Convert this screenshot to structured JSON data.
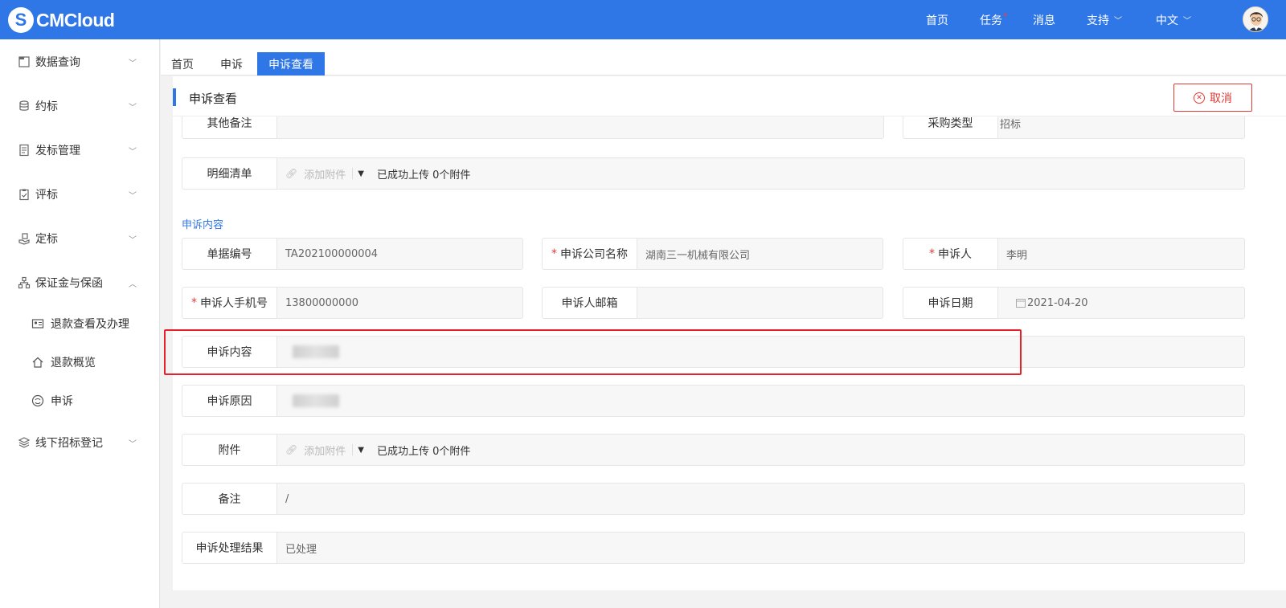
{
  "header": {
    "logo_text": "CMCloud",
    "logo_mark": "S",
    "nav": {
      "home": "首页",
      "tasks": "任务",
      "tasks_badge": "*",
      "messages": "消息",
      "support": "支持",
      "language": "中文"
    }
  },
  "sidebar": {
    "items": [
      {
        "label": "数据查询",
        "icon": "data-query-icon"
      },
      {
        "label": "约标",
        "icon": "coins-icon"
      },
      {
        "label": "发标管理",
        "icon": "document-icon"
      },
      {
        "label": "评标",
        "icon": "clipboard-icon"
      },
      {
        "label": "定标",
        "icon": "hand-icon"
      },
      {
        "label": "保证金与保函",
        "icon": "org-icon"
      }
    ],
    "subitems": [
      {
        "label": "退款查看及办理",
        "icon": "id-card-icon"
      },
      {
        "label": "退款概览",
        "icon": "home-icon"
      },
      {
        "label": "申诉",
        "icon": "appeal-icon"
      }
    ],
    "last_item": {
      "label": "线下招标登记",
      "icon": "layers-icon"
    }
  },
  "tabs": [
    "首页",
    "申诉",
    "申诉查看"
  ],
  "page": {
    "title": "申诉查看",
    "cancel_label": "取消"
  },
  "form": {
    "other_remarks_label": "其他备注",
    "purchase_type_label": "采购类型",
    "purchase_type_value": "招标",
    "detail_list_label": "明细清单",
    "attach_placeholder": "添加附件",
    "attach_status": "已成功上传 0个附件",
    "section_title": "申诉内容",
    "doc_no_label": "单据编号",
    "doc_no_value": "TA202100000004",
    "company_label": "申诉公司名称",
    "company_value": "湖南三一机械有限公司",
    "person_label": "申诉人",
    "person_value": "李明",
    "phone_label": "申诉人手机号",
    "phone_value": "13800000000",
    "email_label": "申诉人邮箱",
    "email_value": "",
    "date_label": "申诉日期",
    "date_value": "2021-04-20",
    "content_label": "申诉内容",
    "reason_label": "申诉原因",
    "attachment_label": "附件",
    "attachment_status": "已成功上传 0个附件",
    "remark_label": "备注",
    "remark_value": "/",
    "result_label": "申诉处理结果",
    "result_value": "已处理"
  },
  "colors": {
    "primary": "#2f77e6",
    "danger": "#e53935",
    "highlight_box": "#e8202a"
  }
}
